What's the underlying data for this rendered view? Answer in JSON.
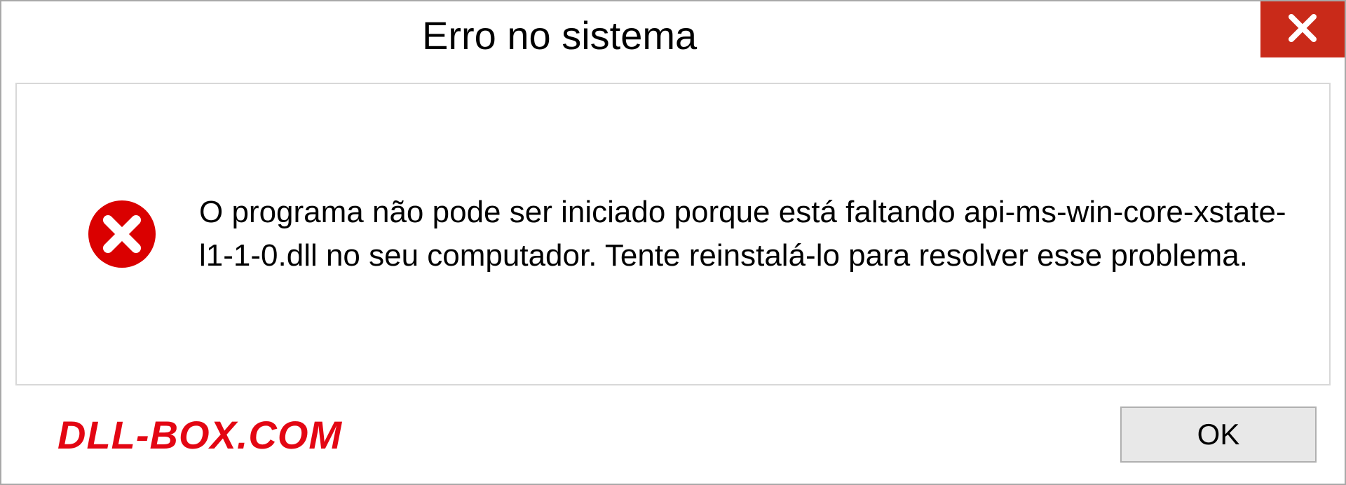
{
  "dialog": {
    "title": "Erro no sistema",
    "message": "O programa não pode ser iniciado porque está faltando api-ms-win-core-xstate-l1-1-0.dll no seu computador. Tente reinstalá-lo para resolver esse problema.",
    "ok_label": "OK"
  },
  "watermark": "DLL-BOX.COM",
  "colors": {
    "close_button": "#c92a19",
    "watermark": "#e30613",
    "error_icon": "#da0000"
  }
}
